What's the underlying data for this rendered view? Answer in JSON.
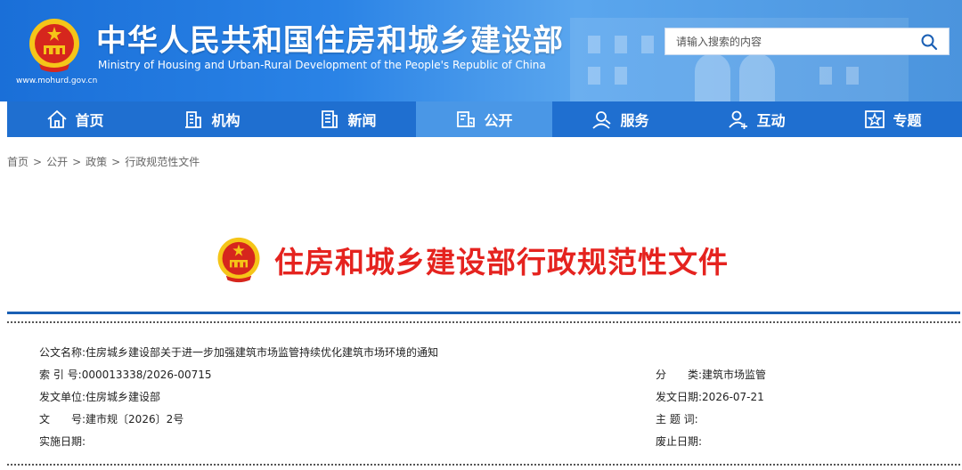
{
  "header": {
    "title_cn": "中华人民共和国住房和城乡建设部",
    "title_en": "Ministry of Housing and Urban-Rural Development of the People's Republic of China",
    "site_url": "www.mohurd.gov.cn",
    "search_placeholder": "请输入搜索的内容"
  },
  "nav": [
    {
      "label": "首页",
      "icon": "home-icon"
    },
    {
      "label": "机构",
      "icon": "building-icon"
    },
    {
      "label": "新闻",
      "icon": "news-icon"
    },
    {
      "label": "公开",
      "icon": "public-icon",
      "active": true
    },
    {
      "label": "服务",
      "icon": "service-icon"
    },
    {
      "label": "互动",
      "icon": "interact-icon"
    },
    {
      "label": "专题",
      "icon": "star-icon"
    }
  ],
  "breadcrumb": [
    "首页",
    "公开",
    "政策",
    "行政规范性文件"
  ],
  "breadcrumb_sep": ">",
  "page_title": "住房和城乡建设部行政规范性文件",
  "meta": {
    "doc_name_label": "公文名称:",
    "doc_name": "住房城乡建设部关于进一步加强建筑市场监管持续优化建筑市场环境的通知",
    "index_label": "索 引 号:",
    "index": "000013338/2026-00715",
    "unit_label": "发文单位:",
    "unit": "住房城乡建设部",
    "number_label": "文　　号:",
    "number": "建市规〔2026〕2号",
    "impl_label": "实施日期:",
    "impl": "",
    "category_label": "分　　类:",
    "category": "建筑市场监管",
    "issue_date_label": "发文日期:",
    "issue_date": "2026-07-21",
    "keywords_label": "主 题 词:",
    "keywords": "",
    "expire_label": "废止日期:",
    "expire": ""
  },
  "colors": {
    "nav_bg": "#1f6fd0",
    "nav_active": "#4a97e6",
    "title_red": "#e5231f",
    "rule_blue": "#1a5fb4"
  }
}
